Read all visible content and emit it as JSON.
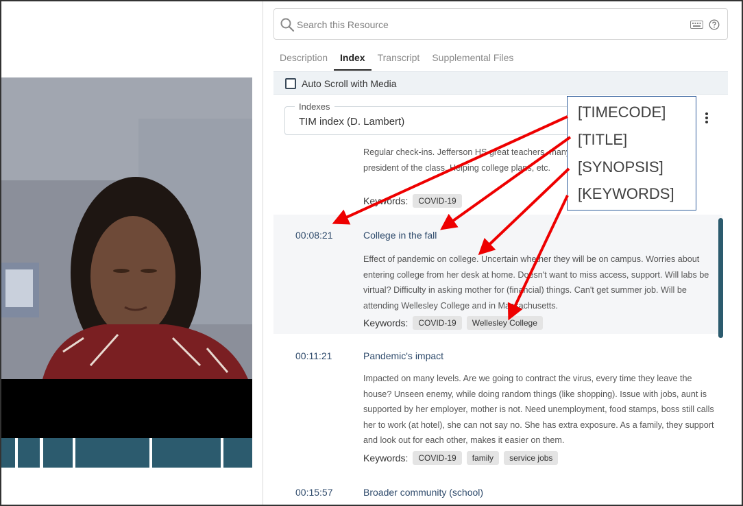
{
  "search": {
    "placeholder": "Search this Resource"
  },
  "tabs": [
    {
      "label": "Description"
    },
    {
      "label": "Index"
    },
    {
      "label": "Transcript"
    },
    {
      "label": "Supplemental Files"
    }
  ],
  "autoscroll": {
    "label": "Auto Scroll with Media",
    "checked": false
  },
  "index_select": {
    "legend": "Indexes",
    "value": "TIM index (D. Lambert)"
  },
  "entries": [
    {
      "timecode": "",
      "title": "",
      "synopsis": "Regular check-ins. Jefferson HS great teachers, many available. An email away. Vice president of the class. Helping college plans, etc.",
      "keywords_label": "Keywords:",
      "keywords": [
        "COVID-19"
      ]
    },
    {
      "timecode": "00:08:21",
      "title": "College in the fall",
      "synopsis": "Effect of pandemic on college. Uncertain whether they will be on campus. Worries about entering college from her desk at home. Doesn't want to miss access, support. Will labs be virtual? Difficulty in asking mother for (financial) things. Can't get summer job. Will be attending Wellesley College and in Massachusetts.",
      "keywords_label": "Keywords:",
      "keywords": [
        "COVID-19",
        "Wellesley College"
      ]
    },
    {
      "timecode": "00:11:21",
      "title": "Pandemic's impact",
      "synopsis": "Impacted on many levels. Are we going to contract the virus, every time they leave the house? Unseen enemy, while doing random things (like shopping). Issue with jobs, aunt is supported by her employer, mother is not. Need unemployment, food stamps, boss still calls her to work (at hotel), she can not say no. She has extra exposure. As a family, they support and look out for each other, makes it easier on them.",
      "keywords_label": "Keywords:",
      "keywords": [
        "COVID-19",
        "family",
        "service jobs"
      ]
    },
    {
      "timecode": "00:15:57",
      "title": "Broader community (school)",
      "synopsis": "",
      "keywords_label": "",
      "keywords": []
    }
  ],
  "callout": {
    "lines": [
      "[TIMECODE]",
      "[TITLE]",
      "[SYNOPSIS]",
      "[KEYWORDS]"
    ]
  },
  "colors": {
    "accent": "#2c5b6e",
    "link": "#2e4a6b",
    "arrow": "#ee0000",
    "callout_border": "#2e5c9a"
  },
  "icons": [
    "search-icon",
    "keyboard-icon",
    "help-icon",
    "more-vertical-icon",
    "checkbox-icon"
  ]
}
